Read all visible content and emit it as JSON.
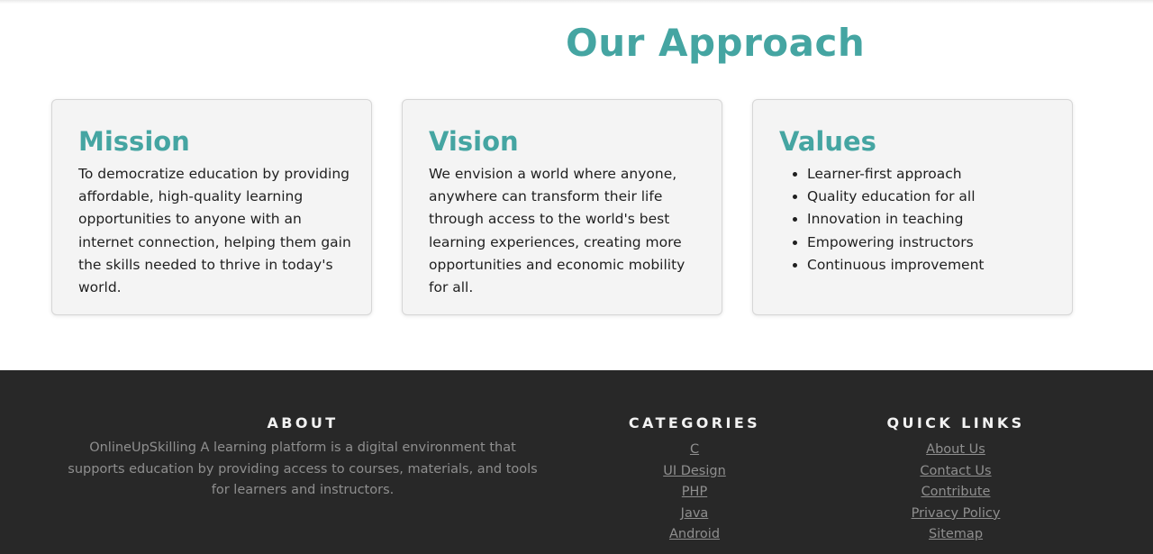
{
  "approach": {
    "title": "Our Approach",
    "cards": [
      {
        "heading": "Mission",
        "text": "To democratize education by providing affordable, high-quality learning opportunities to anyone with an internet connection, helping them gain the skills needed to thrive in today's world."
      },
      {
        "heading": "Vision",
        "text": "We envision a world where anyone, anywhere can transform their life through access to the world's best learning experiences, creating more opportunities and economic mobility for all."
      },
      {
        "heading": "Values",
        "items": [
          "Learner-first approach",
          "Quality education for all",
          "Innovation in teaching",
          "Empowering instructors",
          "Continuous improvement"
        ]
      }
    ]
  },
  "footer": {
    "about": {
      "heading": "ABOUT",
      "text": "OnlineUpSkilling A learning platform is a digital environment that supports education by providing access to courses, materials, and tools for learners and instructors."
    },
    "categories": {
      "heading": "CATEGORIES",
      "links": [
        "C",
        "UI Design",
        "PHP",
        "Java",
        "Android"
      ]
    },
    "quick_links": {
      "heading": "QUICK LINKS",
      "links": [
        "About Us",
        "Contact Us",
        "Contribute",
        "Privacy Policy",
        "Sitemap"
      ]
    }
  },
  "colors": {
    "accent": "#45a5a2",
    "card_background": "#f4f4f4",
    "footer_background": "#282828",
    "footer_text": "#8f8f8f",
    "footer_heading": "#f2f2f2"
  }
}
